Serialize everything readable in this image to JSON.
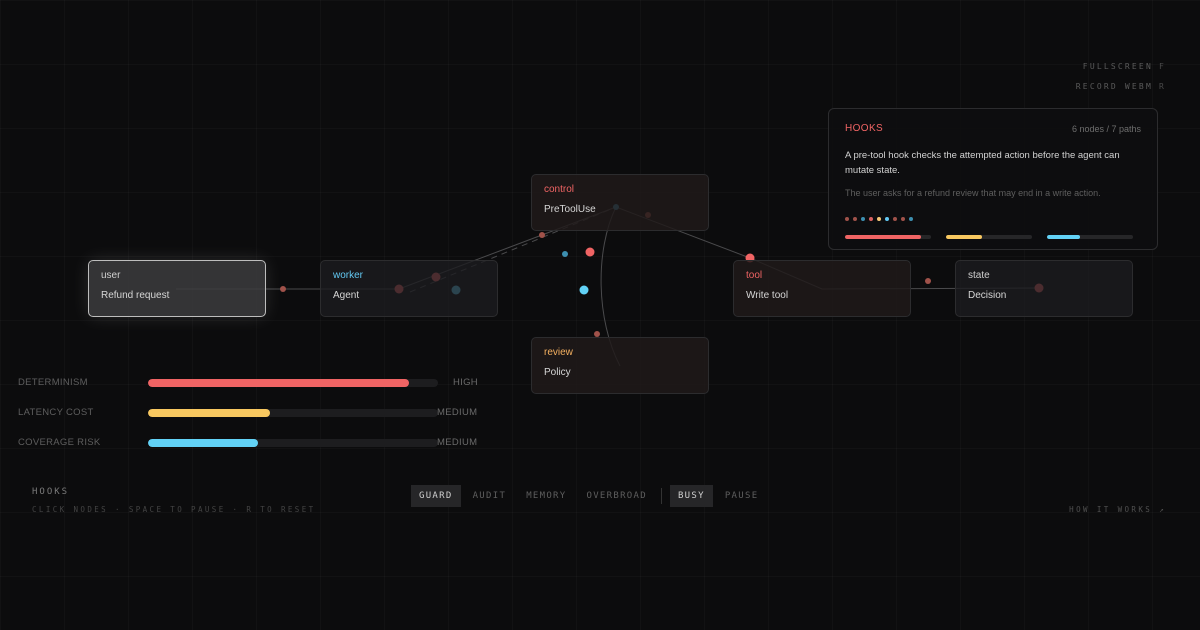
{
  "shortcuts": [
    {
      "label": "FULLSCREEN",
      "key": "F"
    },
    {
      "label": "RECORD WEBM",
      "key": "R"
    }
  ],
  "nodes": {
    "user": {
      "kind": "user",
      "title": "Refund request",
      "color": "#cfcfcf"
    },
    "worker": {
      "kind": "worker",
      "title": "Agent",
      "color": "#62c8f2"
    },
    "control": {
      "kind": "control",
      "title": "PreToolUse",
      "color": "#f06464"
    },
    "review": {
      "kind": "review",
      "title": "Policy",
      "color": "#f5b060"
    },
    "tool": {
      "kind": "tool",
      "title": "Write tool",
      "color": "#f06464"
    },
    "state": {
      "kind": "state",
      "title": "Decision",
      "color": "#cfcfcf"
    }
  },
  "panel": {
    "title": "HOOKS",
    "meta": "6 nodes / 7 paths",
    "description": "A pre-tool hook checks the attempted action before the agent can mutate state.",
    "subtext": "The user asks for a refund review that may end in a write action.",
    "dot_colors": [
      "#a0524a",
      "#a0524a",
      "#3d8fb0",
      "#d86060",
      "#f5c878",
      "#62c8f2",
      "#a0524a",
      "#a0524a",
      "#3d8fb0"
    ],
    "bars": [
      {
        "value": 0.88,
        "color": "#f06464"
      },
      {
        "value": 0.42,
        "color": "#f8c860"
      },
      {
        "value": 0.38,
        "color": "#62d2f6"
      }
    ]
  },
  "metrics": [
    {
      "label": "DETERMINISM",
      "level": "HIGH",
      "value": 0.9,
      "color": "#f06464"
    },
    {
      "label": "LATENCY COST",
      "level": "MEDIUM",
      "value": 0.42,
      "color": "#f8c860"
    },
    {
      "label": "COVERAGE RISK",
      "level": "MEDIUM",
      "value": 0.38,
      "color": "#62d2f6"
    }
  ],
  "footer": {
    "brand": "HOOKS",
    "hint": "CLICK NODES · SPACE TO PAUSE · R TO RESET",
    "howto": "HOW IT WORKS ↗"
  },
  "modes": [
    "GUARD",
    "AUDIT",
    "MEMORY",
    "OVERBROAD"
  ],
  "active_mode": "GUARD",
  "toggles": [
    "BUSY",
    "PAUSE"
  ],
  "active_toggle": "BUSY"
}
